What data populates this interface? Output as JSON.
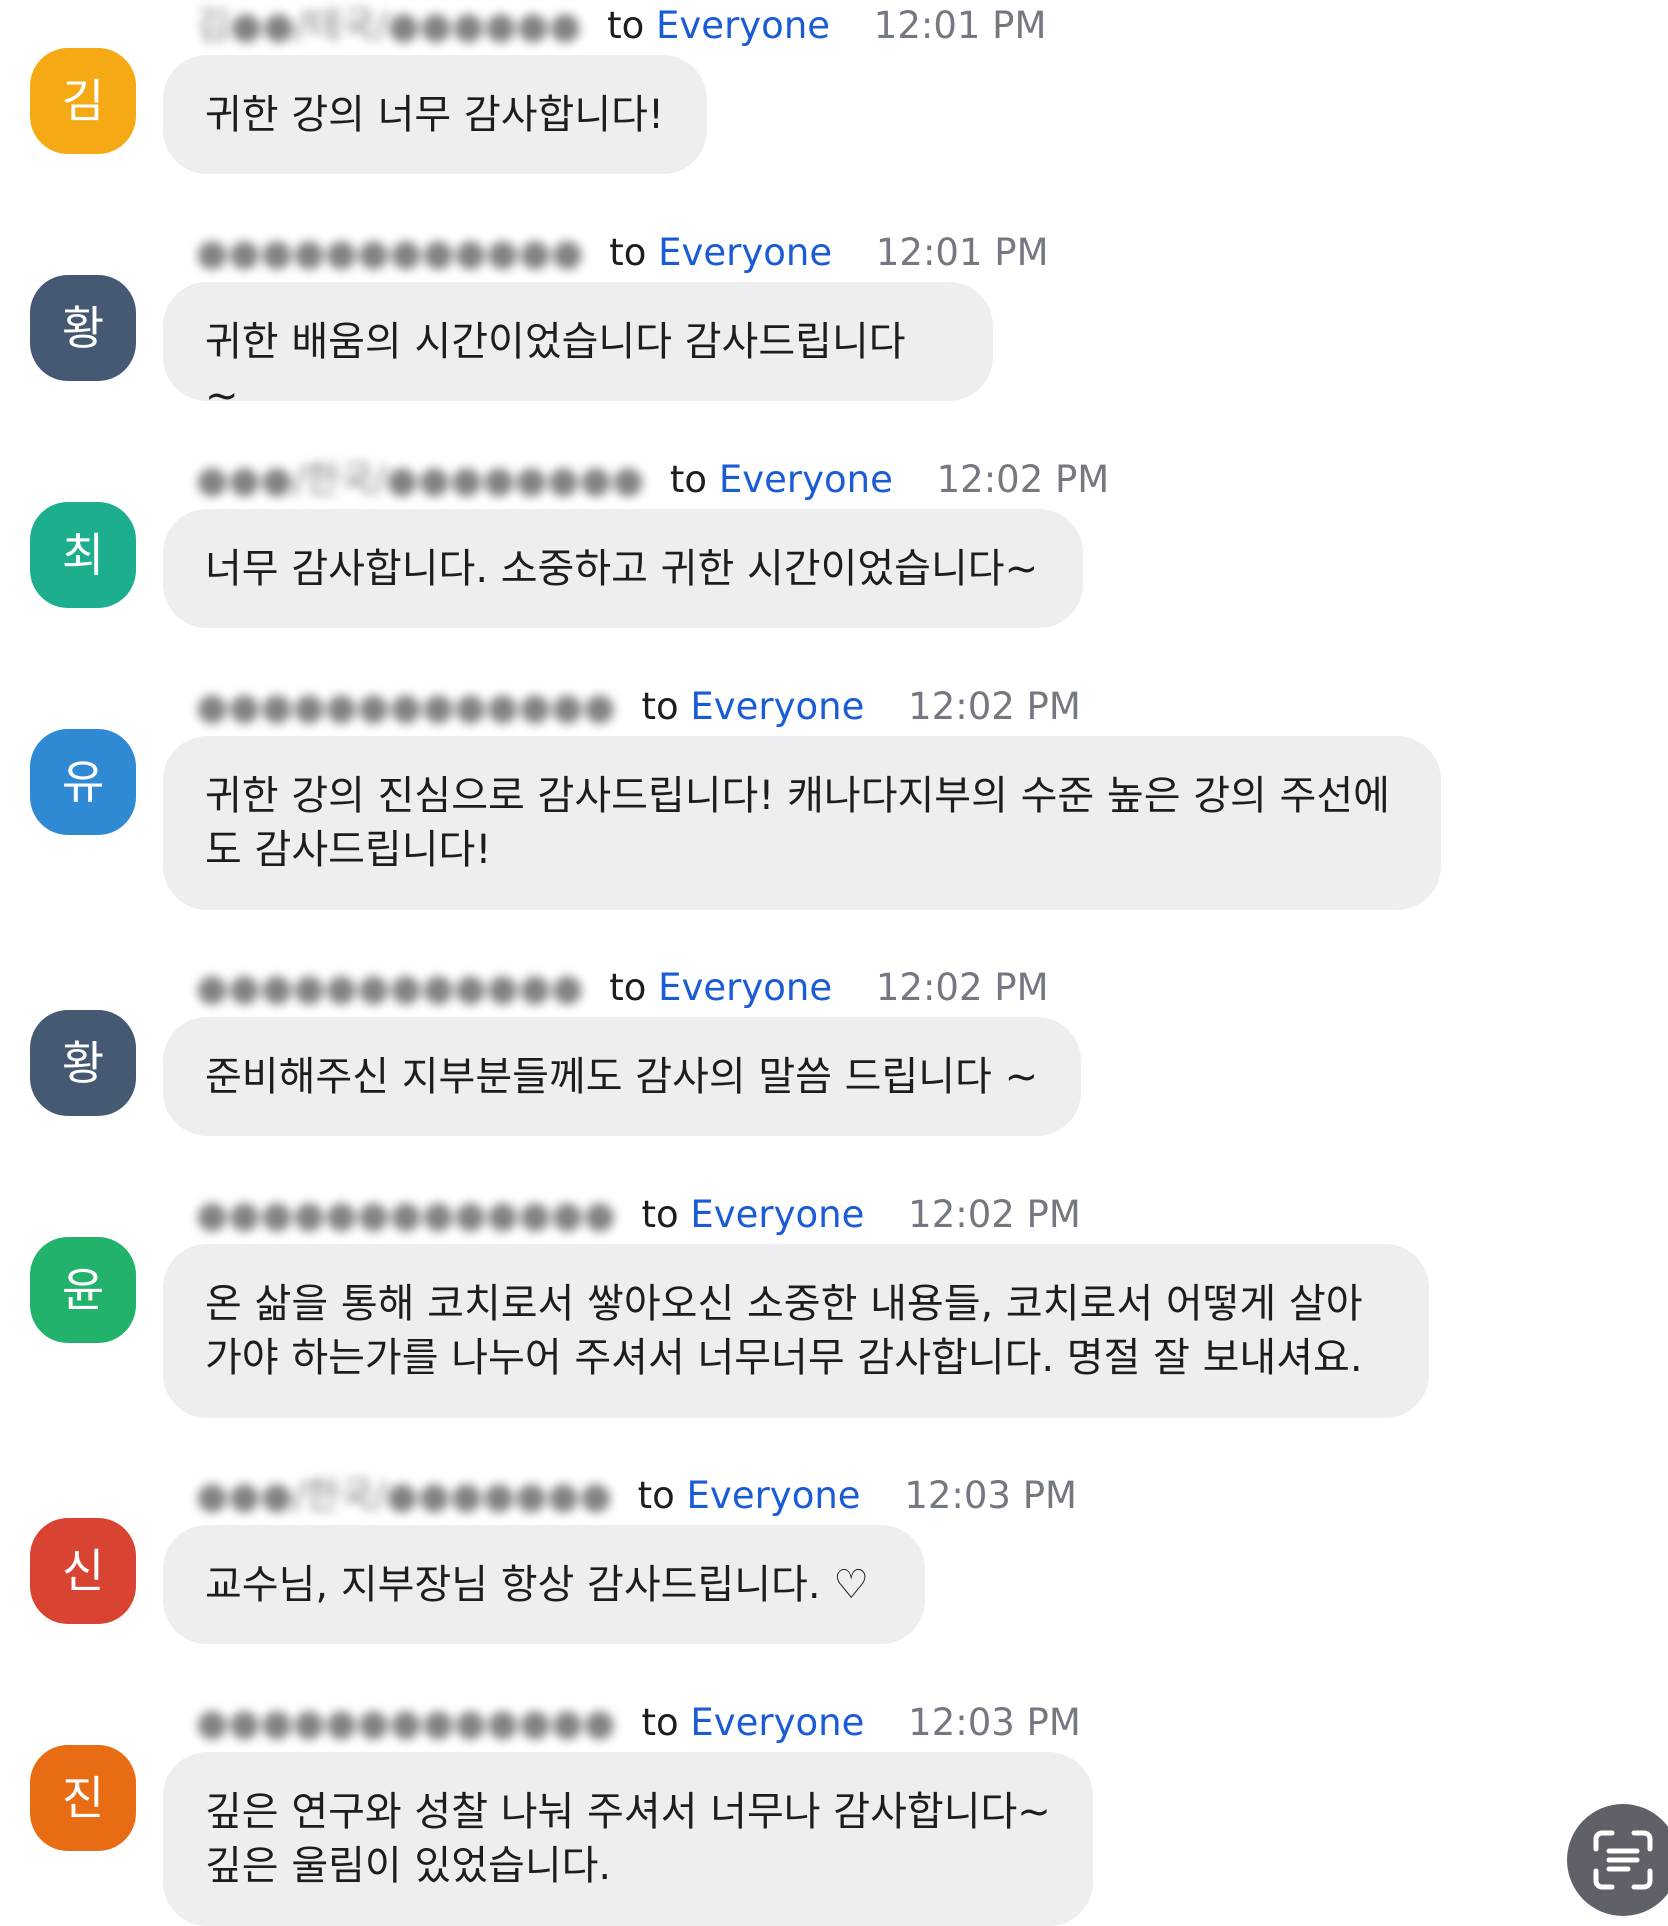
{
  "colors": {
    "recipient_link": "#1a5bd6",
    "bubble_bg": "#eeeef1",
    "timestamp": "#747880"
  },
  "messages": [
    {
      "avatar": "김",
      "avatar_color": "#f5a914",
      "sender": "김●●/테국/●●●●●●",
      "to": "to",
      "recipient": "Everyone",
      "time": "12:01 PM",
      "text": "귀한 강의 너무 감사합니다!"
    },
    {
      "avatar": "황",
      "avatar_color": "#455a72",
      "sender": "●●●●●●●●●●●●",
      "to": "to",
      "recipient": "Everyone",
      "time": "12:01 PM",
      "text": "귀한 배움의 시간이었습니다 감사드립니다 ~"
    },
    {
      "avatar": "최",
      "avatar_color": "#1daf8d",
      "sender": "●●●/한국/●●●●●●●●",
      "to": "to",
      "recipient": "Everyone",
      "time": "12:02 PM",
      "text": "너무 감사합니다. 소중하고 귀한 시간이었습니다~"
    },
    {
      "avatar": "유",
      "avatar_color": "#2f8ad3",
      "sender": "●●●●●●●●●●●●●",
      "to": "to",
      "recipient": "Everyone",
      "time": "12:02 PM",
      "text": "귀한 강의 진심으로 감사드립니다! 캐나다지부의 수준 높은 강의 주선에\n도 감사드립니다!"
    },
    {
      "avatar": "황",
      "avatar_color": "#455a72",
      "sender": "●●●●●●●●●●●●",
      "to": "to",
      "recipient": "Everyone",
      "time": "12:02 PM",
      "text": "준비해주신 지부분들께도 감사의 말씀 드립니다 ~"
    },
    {
      "avatar": "윤",
      "avatar_color": "#22b26b",
      "sender": "●●●●●●●●●●●●●",
      "to": "to",
      "recipient": "Everyone",
      "time": "12:02 PM",
      "text": "온 삶을 통해 코치로서 쌓아오신 소중한 내용들, 코치로서 어떻게 살아\n가야 하는가를 나누어 주셔서 너무너무 감사합니다.  명절 잘 보내셔요."
    },
    {
      "avatar": "신",
      "avatar_color": "#d94432",
      "sender": "●●●/한국/●●●●●●●",
      "to": "to",
      "recipient": "Everyone",
      "time": "12:03 PM",
      "text": "교수님, 지부장님 항상 감사드립니다. ♡"
    },
    {
      "avatar": "진",
      "avatar_color": "#e86c13",
      "sender": "●●●●●●●●●●●●●",
      "to": "to",
      "recipient": "Everyone",
      "time": "12:03 PM",
      "text": "깊은 연구와 성찰 나눠 주셔서 너무나 감사합니다~\n깊은 울림이 있었습니다."
    }
  ],
  "fab": {
    "icon": "caption-scan-icon"
  }
}
